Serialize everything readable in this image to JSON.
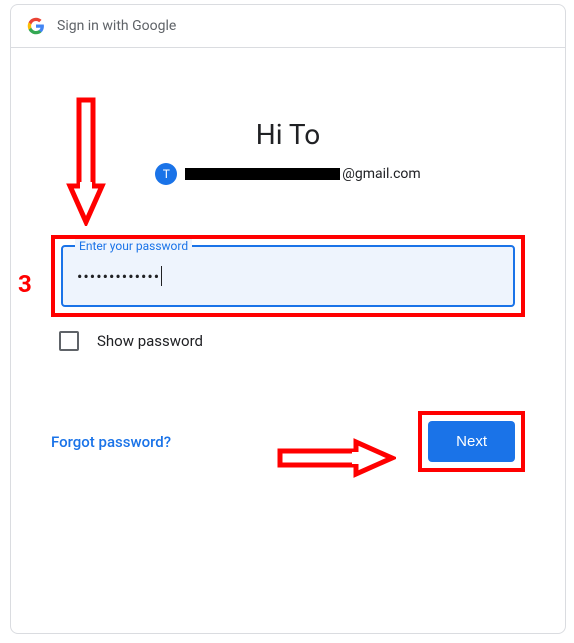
{
  "header": {
    "title": "Sign in with Google"
  },
  "greeting": "Hi To",
  "avatar_initial": "T",
  "email_domain": "@gmail.com",
  "password": {
    "label": "Enter your password",
    "value_masked": "•••••••••••••"
  },
  "show_password_label": "Show password",
  "forgot_label": "Forgot password?",
  "next_label": "Next",
  "annotation_number": "3"
}
